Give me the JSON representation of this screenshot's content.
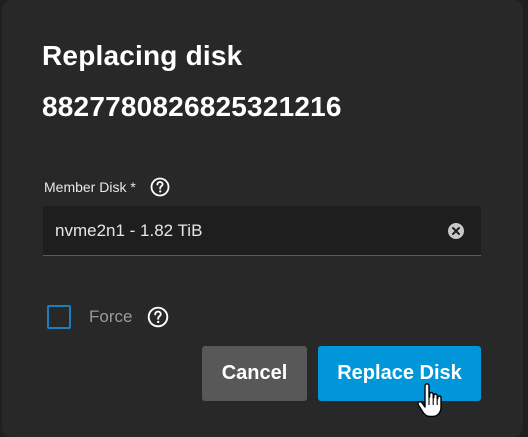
{
  "dialog": {
    "title_line1": "Replacing disk",
    "title_line2": "8827780826825321216"
  },
  "member_disk": {
    "label": "Member Disk *",
    "value": "nvme2n1 - 1.82 TiB",
    "help_icon": "help-circle-icon",
    "clear_icon": "clear-circle-icon"
  },
  "force": {
    "label": "Force",
    "checked": false,
    "help_icon": "help-circle-icon"
  },
  "buttons": {
    "cancel": "Cancel",
    "replace": "Replace Disk"
  },
  "colors": {
    "dialog_bg": "#282828",
    "primary": "#0096d9",
    "cancel_bg": "#585858",
    "checkbox_border": "#1b7fbf"
  }
}
